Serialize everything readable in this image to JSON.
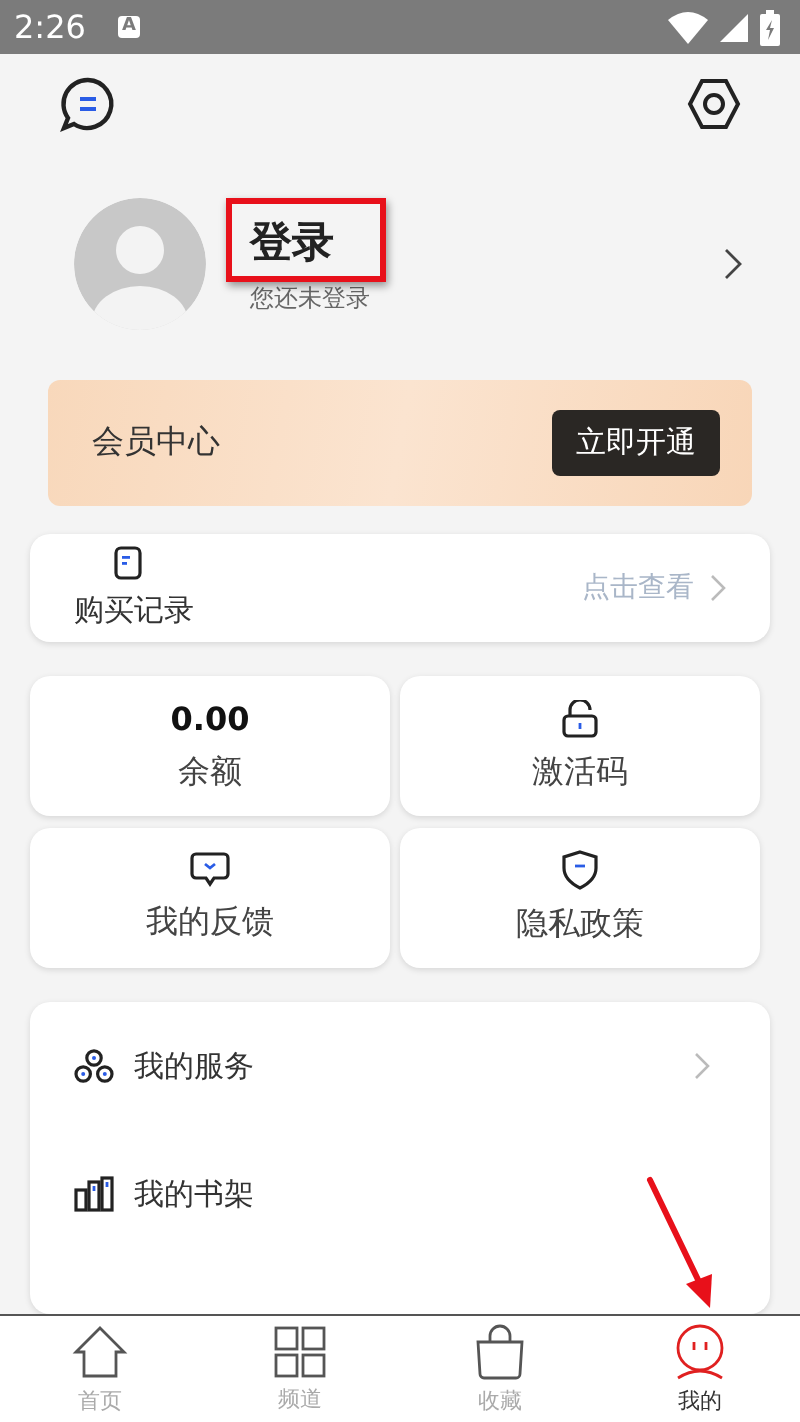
{
  "status_bar": {
    "time": "2:26",
    "notification": "A"
  },
  "profile": {
    "title": "登录",
    "subtitle": "您还未登录"
  },
  "member": {
    "label": "会员中心",
    "button": "立即开通"
  },
  "purchase": {
    "label": "购买记录",
    "link": "点击查看"
  },
  "grid": [
    {
      "kind": "value",
      "value": "0.00",
      "label": "余额"
    },
    {
      "kind": "lock",
      "label": "激活码"
    },
    {
      "kind": "feedback",
      "label": "我的反馈"
    },
    {
      "kind": "shield",
      "label": "隐私政策"
    }
  ],
  "services": [
    {
      "kind": "services",
      "label": "我的服务",
      "chevron": true
    },
    {
      "kind": "shelf",
      "label": "我的书架",
      "chevron": false
    }
  ],
  "tabs": [
    {
      "kind": "home",
      "label": "首页",
      "selected": false
    },
    {
      "kind": "grid",
      "label": "频道",
      "selected": false
    },
    {
      "kind": "bag",
      "label": "收藏",
      "selected": false
    },
    {
      "kind": "face",
      "label": "我的",
      "selected": true
    }
  ]
}
